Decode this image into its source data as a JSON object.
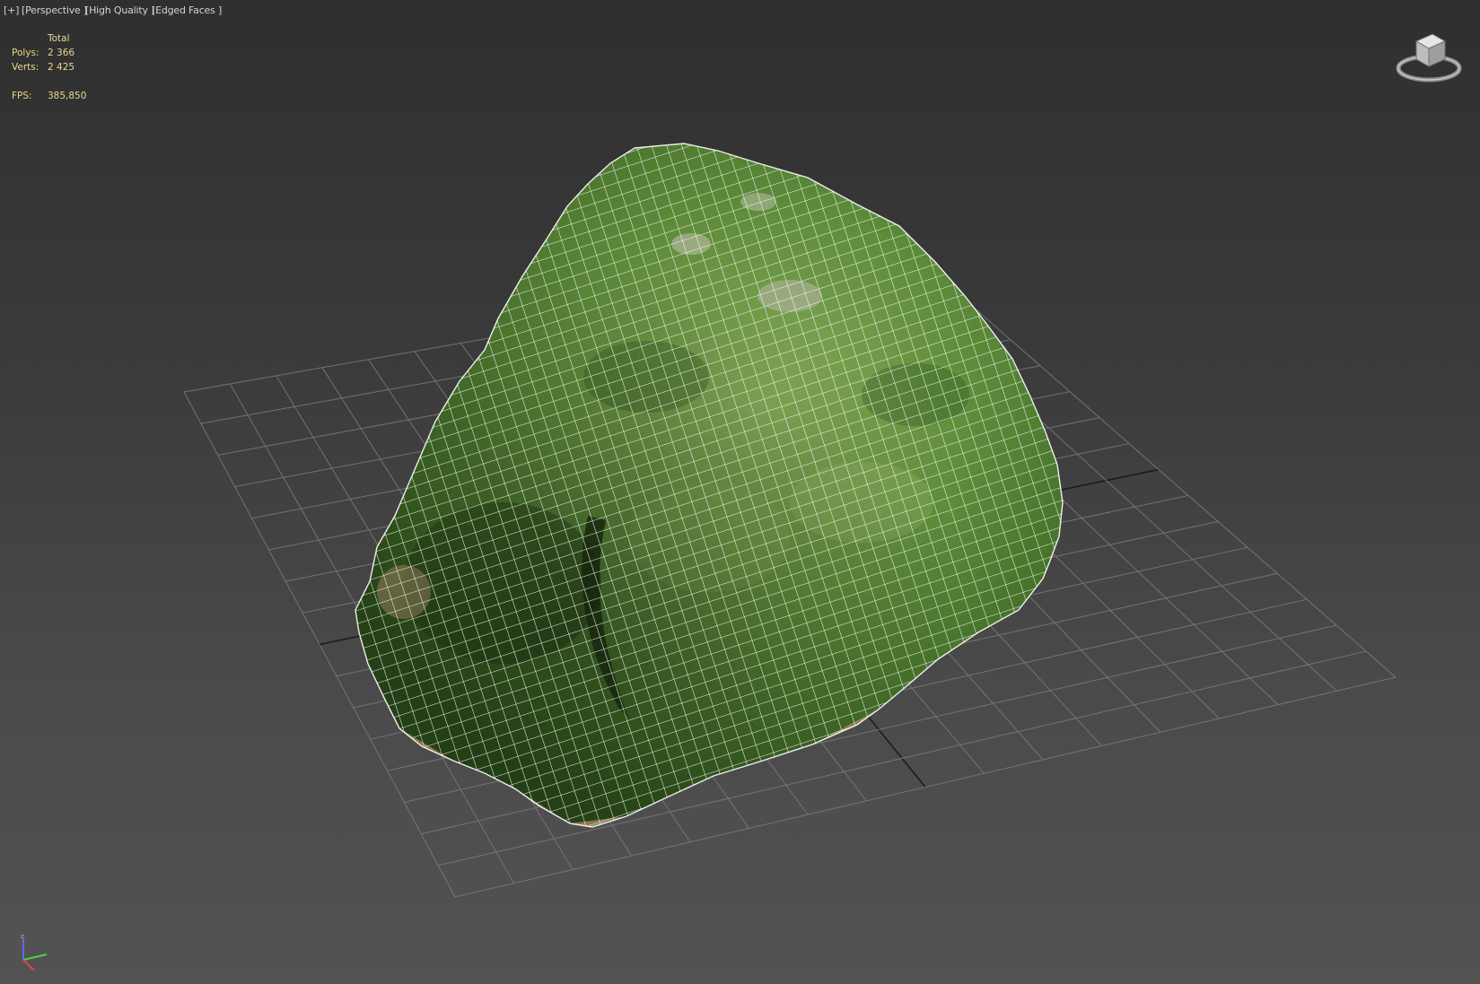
{
  "viewport": {
    "labels": [
      {
        "text": "[+]"
      },
      {
        "text": "[Perspective ]"
      },
      {
        "text": "[High Quality ]"
      },
      {
        "text": "[Edged Faces ]"
      }
    ]
  },
  "stats": {
    "header": "Total",
    "polys_label": "Polys:",
    "polys_value": "2 366",
    "verts_label": "Verts:",
    "verts_value": "2 425",
    "fps_label": "FPS:",
    "fps_value": "385,850"
  },
  "colors": {
    "viewport_bg_top": "#2f2f2f",
    "viewport_bg_bottom": "#535353",
    "grid_line": "#7a7a7a",
    "grid_axis": "#141414",
    "stats_text": "#e8d890",
    "label_text": "#d2d2d2",
    "mesh_fill": "#4e7a33",
    "mesh_wire": "#ffffff"
  },
  "icons": {
    "viewcube": "viewcube-icon",
    "tripod": "axis-tripod-icon"
  }
}
